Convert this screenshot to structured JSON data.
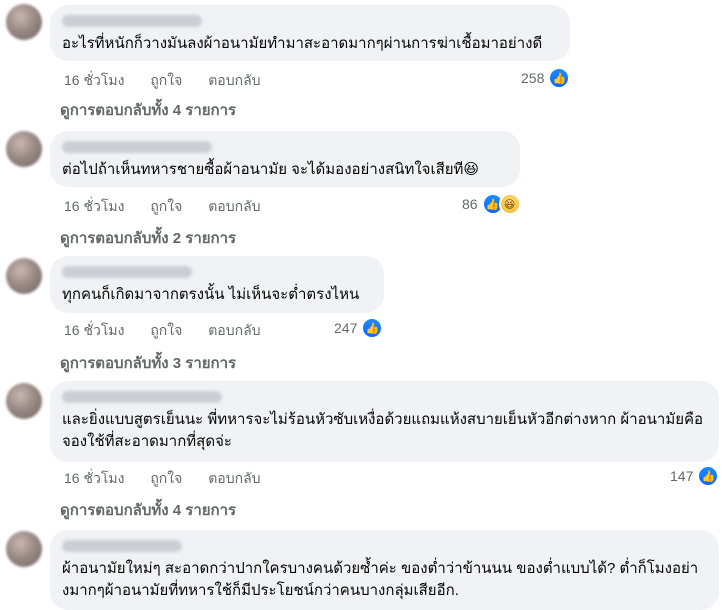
{
  "comments": [
    {
      "text": "อะไรที่หนักก็วางมันลงผ้าอนามัยทำมาสะอาดมากๆผ่านการฆ่าเชื้อมาอย่างดี",
      "time": "16 ชั่วโมง",
      "like_label": "ถูกใจ",
      "reply_label": "ตอบกลับ",
      "reactions": "258",
      "reaction_icons": [
        "like-icon"
      ],
      "replies": "ดูการตอบกลับทั้ง 4 รายการ"
    },
    {
      "text": "ต่อไปถ้าเห็นทหารชายซื้อผ้าอนามัย จะได้มองอย่างสนิทใจเสียที😆",
      "time": "16 ชั่วโมง",
      "like_label": "ถูกใจ",
      "reply_label": "ตอบกลับ",
      "reactions": "86",
      "reaction_icons": [
        "like-icon",
        "haha-icon"
      ],
      "replies": "ดูการตอบกลับทั้ง 2 รายการ"
    },
    {
      "text": "ทุกคนก็เกิดมาจากตรงนั้น ไม่เห็นจะต่ำตรงไหน",
      "time": "16 ชั่วโมง",
      "like_label": "ถูกใจ",
      "reply_label": "ตอบกลับ",
      "reactions": "247",
      "reaction_icons": [
        "like-icon"
      ],
      "replies": "ดูการตอบกลับทั้ง 3 รายการ"
    },
    {
      "text": "และยิ่งแบบสูตรเย็นนะ พี่ทหารจะไม่ร้อนหัวซับเหงื่อด้วยแถมแห้งสบายเย็นหัวอีกต่างหาก ผ้าอนามัยคือจองใช้ที่สะอาดมากที่สุดจ่ะ",
      "time": "16 ชั่วโมง",
      "like_label": "ถูกใจ",
      "reply_label": "ตอบกลับ",
      "reactions": "147",
      "reaction_icons": [
        "like-icon"
      ],
      "replies": "ดูการตอบกลับทั้ง 4 รายการ"
    },
    {
      "text": "ผ้าอนามัยใหม่ๆ สะอาดกว่าปากใครบางคนด้วยซ้ำค่ะ ของต่ำว่าข้านนน ของต่ำแบบได้? ต่ำก็โมงอย่างมากๆผ้าอนามัยที่ทหารใช้ก็มีประโยชน์กว่าคนบางกลุ่มเสียอีก."
    }
  ],
  "colors": {
    "bubble": "#f0f2f5",
    "meta": "#65676b",
    "like": "#0866ff"
  }
}
